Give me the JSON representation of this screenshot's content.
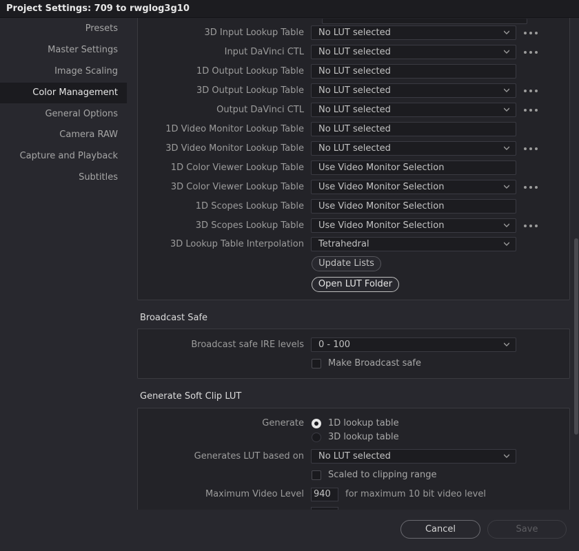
{
  "window": {
    "title": "Project Settings:  709 to rwglog3g10"
  },
  "sidebar": {
    "items": [
      {
        "label": "Presets"
      },
      {
        "label": "Master Settings"
      },
      {
        "label": "Image Scaling"
      },
      {
        "label": "Color Management",
        "active": true
      },
      {
        "label": "General Options"
      },
      {
        "label": "Camera RAW"
      },
      {
        "label": "Capture and Playback"
      },
      {
        "label": "Subtitles"
      }
    ]
  },
  "lookup_tables": {
    "rows": [
      {
        "label": "3D Input Lookup Table",
        "value": "No LUT selected"
      },
      {
        "label": "Input DaVinci CTL",
        "value": "No LUT selected"
      },
      {
        "label": "1D Output Lookup Table",
        "value": "No LUT selected"
      },
      {
        "label": "3D Output Lookup Table",
        "value": "No LUT selected"
      },
      {
        "label": "Output DaVinci CTL",
        "value": "No LUT selected"
      },
      {
        "label": "1D Video Monitor Lookup Table",
        "value": "No LUT selected"
      },
      {
        "label": "3D Video Monitor Lookup Table",
        "value": "No LUT selected"
      },
      {
        "label": "1D Color Viewer Lookup Table",
        "value": "Use Video Monitor Selection"
      },
      {
        "label": "3D Color Viewer Lookup Table",
        "value": "Use Video Monitor Selection"
      },
      {
        "label": "1D Scopes Lookup Table",
        "value": "Use Video Monitor Selection"
      },
      {
        "label": "3D Scopes Lookup Table",
        "value": "Use Video Monitor Selection"
      },
      {
        "label": "3D Lookup Table Interpolation",
        "value": "Tetrahedral"
      }
    ],
    "update_lists": "Update Lists",
    "open_lut_folder": "Open LUT Folder"
  },
  "broadcast_safe": {
    "title": "Broadcast Safe",
    "ire_label": "Broadcast safe IRE levels",
    "ire_value": "0 - 100",
    "make_safe_label": "Make Broadcast safe"
  },
  "soft_clip": {
    "title": "Generate Soft Clip LUT",
    "generate_label": "Generate",
    "option_1d": "1D lookup table",
    "option_3d": "3D lookup table",
    "based_on_label": "Generates LUT based on",
    "based_on_value": "No LUT selected",
    "scaled_label": "Scaled to clipping range",
    "max_video_label": "Maximum Video Level",
    "max_video_value": "940",
    "max_video_suffix": "for maximum 10 bit video level"
  },
  "footer": {
    "cancel": "Cancel",
    "save": "Save"
  },
  "colors": {
    "background": "#28282e",
    "panel": "#232328",
    "active_nav": "#1b1b1f"
  }
}
